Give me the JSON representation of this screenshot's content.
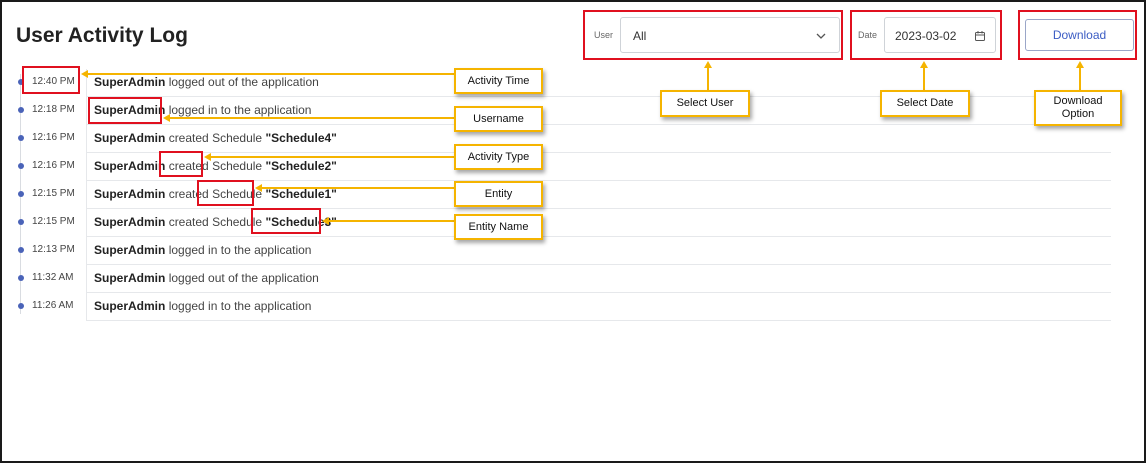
{
  "header": {
    "title": "User Activity Log"
  },
  "filters": {
    "user_label": "User",
    "user_value": "All",
    "date_label": "Date",
    "date_value": "2023-03-02",
    "download_label": "Download"
  },
  "logs": [
    {
      "time": "12:40 PM",
      "user": "SuperAdmin",
      "action": "logged out of the application",
      "entity": "",
      "entity_name": ""
    },
    {
      "time": "12:18 PM",
      "user": "SuperAdmin",
      "action": "logged in to the application",
      "entity": "",
      "entity_name": ""
    },
    {
      "time": "12:16 PM",
      "user": "SuperAdmin",
      "action": "created",
      "entity": "Schedule",
      "entity_name": "\"Schedule4\""
    },
    {
      "time": "12:16 PM",
      "user": "SuperAdmin",
      "action": "created",
      "entity": "Schedule",
      "entity_name": "\"Schedule2\""
    },
    {
      "time": "12:15 PM",
      "user": "SuperAdmin",
      "action": "created",
      "entity": "Schedule",
      "entity_name": "\"Schedule1\""
    },
    {
      "time": "12:15 PM",
      "user": "SuperAdmin",
      "action": "created",
      "entity": "Schedule",
      "entity_name": "\"Schedule3\""
    },
    {
      "time": "12:13 PM",
      "user": "SuperAdmin",
      "action": "logged in to the application",
      "entity": "",
      "entity_name": ""
    },
    {
      "time": "11:32 AM",
      "user": "SuperAdmin",
      "action": "logged out of the application",
      "entity": "",
      "entity_name": ""
    },
    {
      "time": "11:26 AM",
      "user": "SuperAdmin",
      "action": "logged in to the application",
      "entity": "",
      "entity_name": ""
    }
  ],
  "callouts": {
    "activity_time": "Activity Time",
    "username": "Username",
    "activity_type": "Activity Type",
    "entity": "Entity",
    "entity_name": "Entity Name",
    "select_user": "Select User",
    "select_date": "Select Date",
    "download_option_line1": "Download",
    "download_option_line2": "Option"
  },
  "icons": {
    "user_dropdown": "chevron-down-icon",
    "date_picker": "calendar-icon",
    "timeline": "timeline-dot-icon"
  },
  "colors": {
    "highlight": "#e0101f",
    "callout_border": "#f5b400",
    "accent": "#3b5cc4",
    "timeline_dot": "#4a63b8"
  }
}
